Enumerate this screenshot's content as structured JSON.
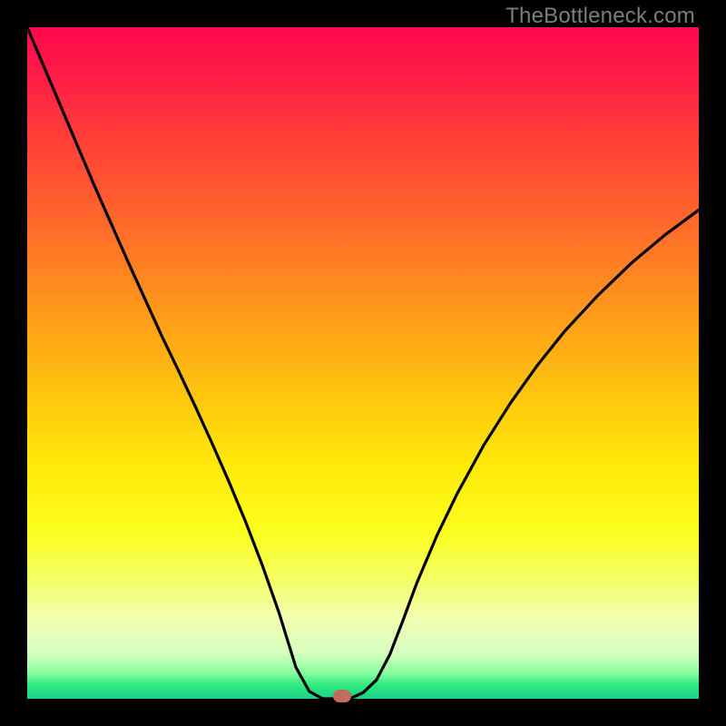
{
  "watermark": "TheBottleneck.com",
  "chart_data": {
    "type": "line",
    "title": "",
    "xlabel": "",
    "ylabel": "",
    "xlim": [
      0,
      1
    ],
    "ylim": [
      0,
      1
    ],
    "series": [
      {
        "name": "bottleneck-curve",
        "x": [
          0.0,
          0.05,
          0.1,
          0.15,
          0.2,
          0.225,
          0.25,
          0.275,
          0.3,
          0.325,
          0.35,
          0.375,
          0.4,
          0.42,
          0.44,
          0.455,
          0.48,
          0.5,
          0.52,
          0.54,
          0.56,
          0.58,
          0.61,
          0.64,
          0.68,
          0.72,
          0.76,
          0.8,
          0.85,
          0.9,
          0.95,
          1.0
        ],
        "values": [
          1.0,
          0.882,
          0.764,
          0.651,
          0.541,
          0.489,
          0.436,
          0.381,
          0.324,
          0.264,
          0.199,
          0.128,
          0.047,
          0.011,
          0.0,
          0.0,
          0.0,
          0.009,
          0.028,
          0.066,
          0.118,
          0.172,
          0.243,
          0.305,
          0.378,
          0.441,
          0.497,
          0.547,
          0.601,
          0.649,
          0.691,
          0.728
        ]
      }
    ],
    "annotations": [
      {
        "name": "optimal-marker",
        "x": 0.469,
        "y": 0.0
      }
    ],
    "background_gradient_stops": [
      {
        "pos": 0.0,
        "color": "#ff094e"
      },
      {
        "pos": 0.5,
        "color": "#ffb210"
      },
      {
        "pos": 0.8,
        "color": "#f8ff40"
      },
      {
        "pos": 1.0,
        "color": "#1fcf86"
      }
    ]
  }
}
